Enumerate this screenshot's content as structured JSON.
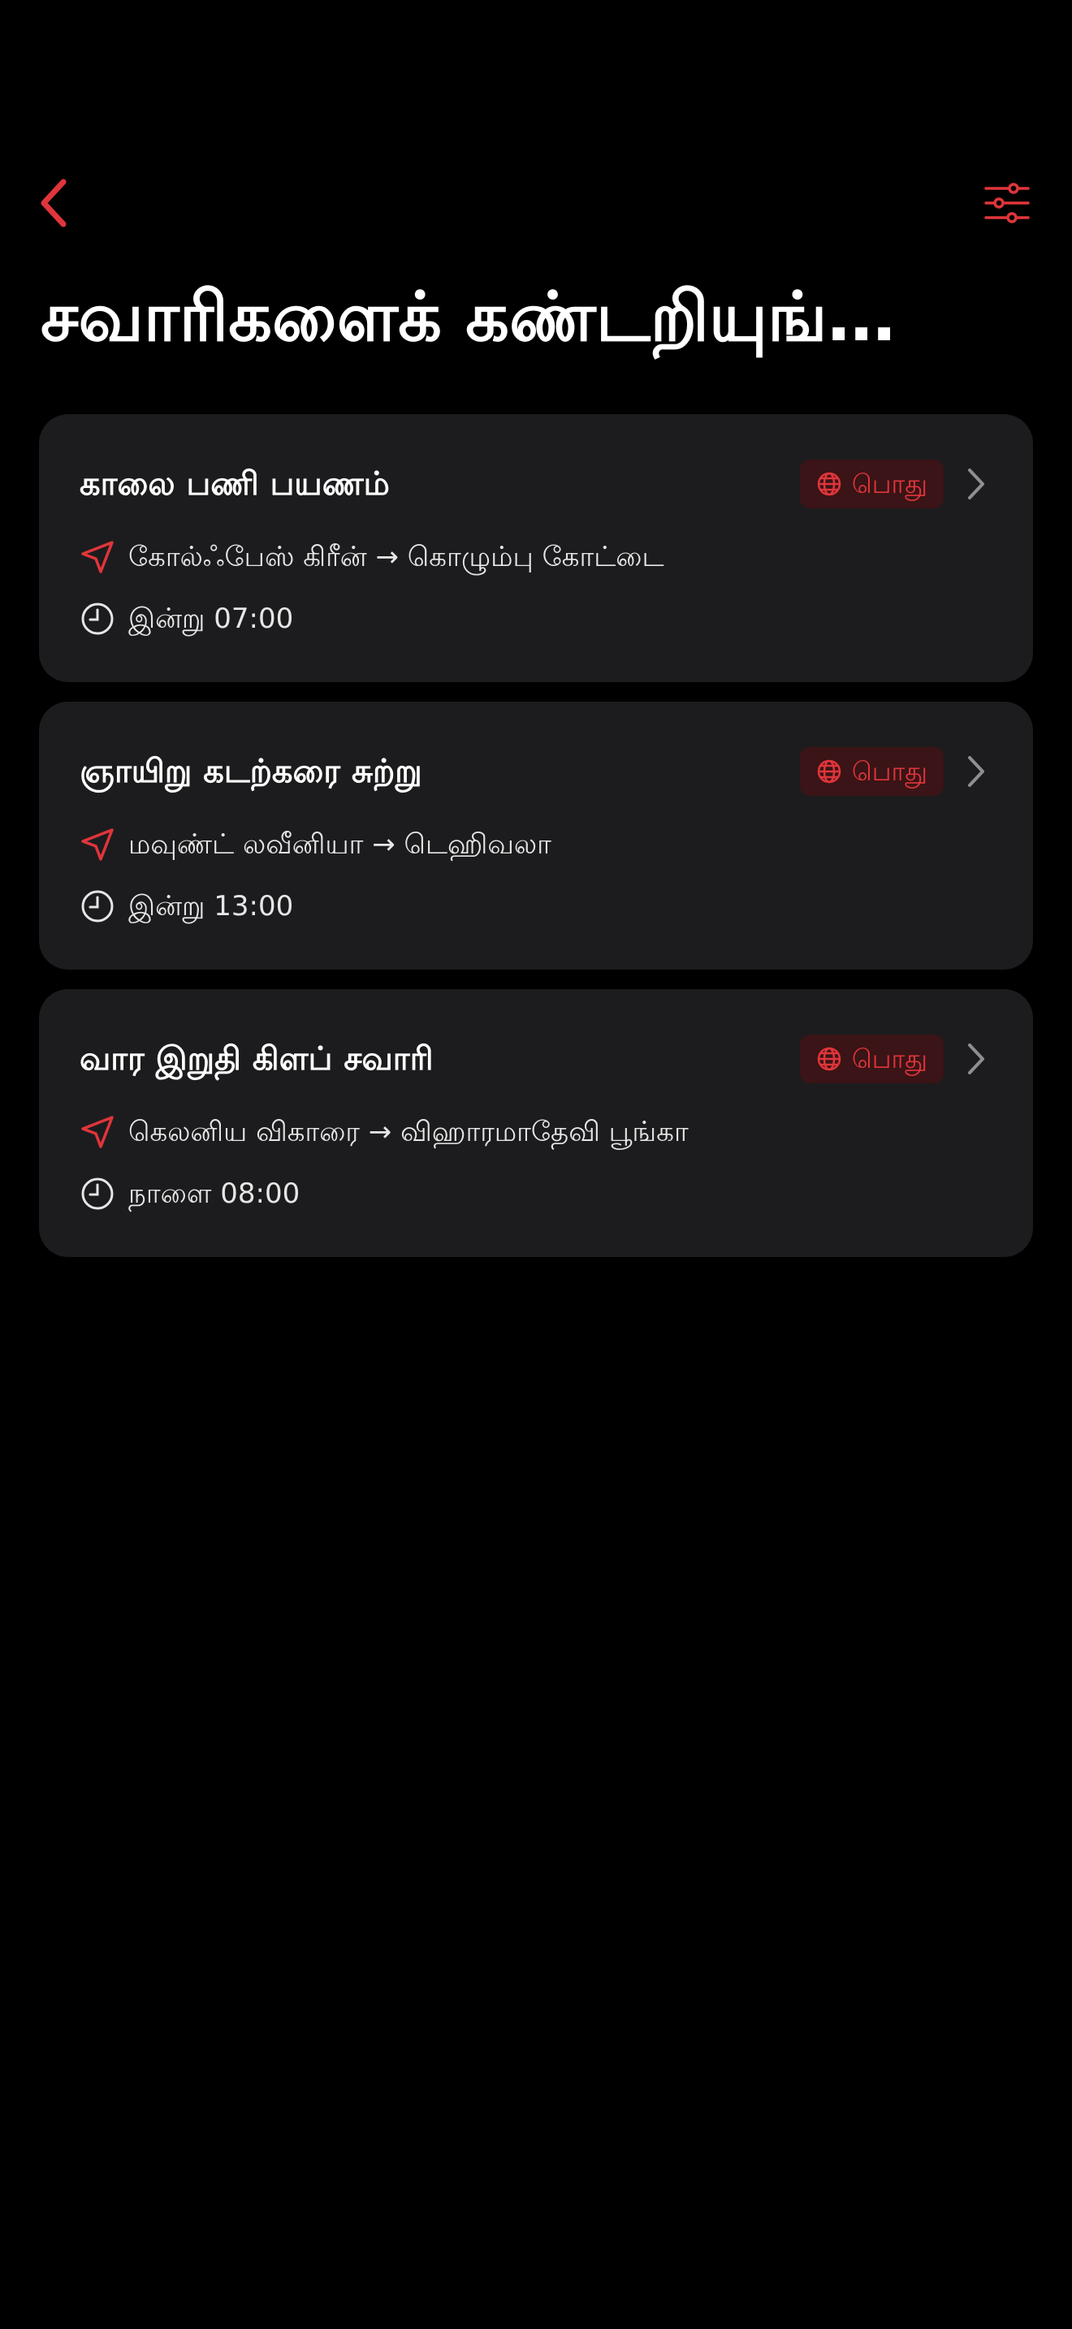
{
  "header": {
    "title": "சவாரிகளைக் கண்டறியுங்…",
    "back_icon": "chevron-left-icon",
    "filter_icon": "sliders-icon"
  },
  "colors": {
    "accent": "#e0353b",
    "card_background": "#1c1c1e",
    "badge_background": "#3a1416"
  },
  "rides": [
    {
      "name": "காலை பணி பயணம்",
      "badge": "பொது",
      "route": "கோல்ஃபேஸ் கிரீன் → கொழும்பு கோட்டை",
      "time": "இன்று 07:00"
    },
    {
      "name": "ஞாயிறு கடற்கரை சுற்று",
      "badge": "பொது",
      "route": "மவுண்ட் லவீனியா → டெஹிவலா",
      "time": "இன்று 13:00"
    },
    {
      "name": "வார இறுதி கிளப் சவாரி",
      "badge": "பொது",
      "route": "கெலனிய விகாரை → விஹாரமாதேவி பூங்கா",
      "time": "நாளை 08:00"
    }
  ]
}
